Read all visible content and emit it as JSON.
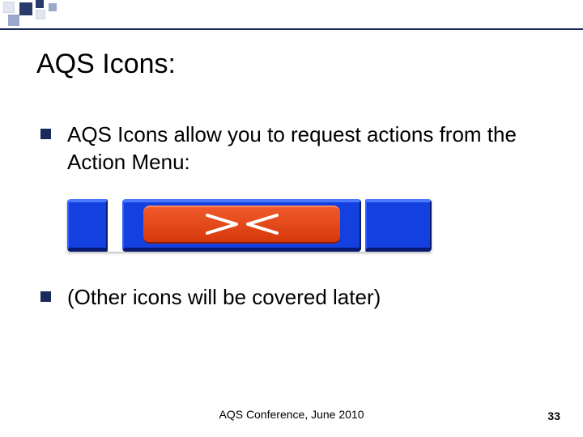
{
  "title": "AQS Icons:",
  "bullets": [
    "AQS Icons allow you to request actions from the Action Menu:",
    "(Other icons will be covered later)"
  ],
  "footer": "AQS Conference, June 2010",
  "page_number": "33"
}
